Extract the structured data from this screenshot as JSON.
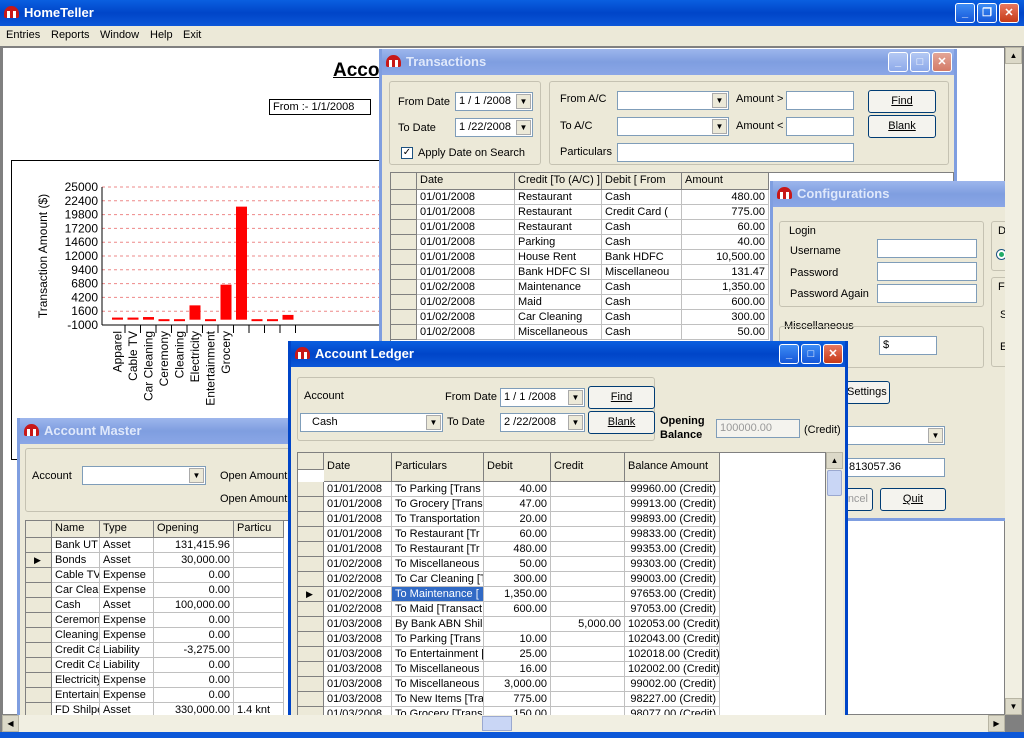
{
  "app": {
    "title": "HomeTeller",
    "menu": [
      "Entries",
      "Reports",
      "Window",
      "Help",
      "Exit"
    ]
  },
  "report": {
    "title": "Acco",
    "from_label": "From :- 1/1/2008",
    "ylabel": "Transaction Amount ($)",
    "chart_data": {
      "type": "bar",
      "title": "",
      "xlabel": "",
      "ylabel": "Transaction Amount ($)",
      "yticks": [
        25000,
        22400,
        19800,
        17200,
        14600,
        12000,
        9400,
        6800,
        4200,
        1600,
        -1000
      ],
      "ylim": [
        -1000,
        25000
      ],
      "grid": true,
      "colors": [
        "#ff0000"
      ],
      "categories": [
        "Apparel",
        "Cable TV",
        "Car Cleaning",
        "Ceremony",
        "Cleaning",
        "Electricity",
        "Entertainment",
        "Grocery",
        "",
        "",
        "",
        ""
      ],
      "values": [
        400,
        400,
        500,
        100,
        100,
        2700,
        100,
        6600,
        21300,
        100,
        100,
        900
      ]
    }
  },
  "transactions": {
    "title": "Transactions",
    "from_date_label": "From Date",
    "from_date": "1 / 1 /2008",
    "to_date_label": "To Date",
    "to_date": "1 /22/2008",
    "apply_label": "Apply Date on Search",
    "from_ac_label": "From A/C",
    "to_ac_label": "To A/C",
    "amount_gt_label": "Amount >",
    "amount_lt_label": "Amount <",
    "particulars_label": "Particulars",
    "find": "Find",
    "blank": "Blank",
    "columns": [
      "Date",
      "Credit [To (A/C) ]",
      "Debit [ From",
      "Amount"
    ],
    "rows": [
      [
        "01/01/2008",
        "Restaurant",
        "Cash",
        "480.00"
      ],
      [
        "01/01/2008",
        "Restaurant",
        "Credit Card (",
        "775.00"
      ],
      [
        "01/01/2008",
        "Restaurant",
        "Cash",
        "60.00"
      ],
      [
        "01/01/2008",
        "Parking",
        "Cash",
        "40.00"
      ],
      [
        "01/01/2008",
        "House Rent",
        "Bank HDFC",
        "10,500.00"
      ],
      [
        "01/01/2008",
        "Bank HDFC SI",
        "Miscellaneou",
        "131.47"
      ],
      [
        "01/02/2008",
        "Maintenance",
        "Cash",
        "1,350.00"
      ],
      [
        "01/02/2008",
        "Maid",
        "Cash",
        "600.00"
      ],
      [
        "01/02/2008",
        "Car Cleaning",
        "Cash",
        "300.00"
      ],
      [
        "01/02/2008",
        "Miscellaneous",
        "Cash",
        "50.00"
      ]
    ]
  },
  "config": {
    "title": "Configurations",
    "login_label": "Login",
    "username_label": "Username",
    "password_label": "Password",
    "password_again_label": "Password Again",
    "misc_label": "Miscellaneous",
    "currency_value": "$",
    "settings_btn": "Settings",
    "group_d": "D",
    "group_fi": "Fi",
    "s_label": "S",
    "e_label": "E",
    "balance": "813057.36",
    "cancel": "ncel",
    "quit": "Quit"
  },
  "account_master": {
    "title": "Account Master",
    "account_label": "Account",
    "open_amount_label": "Open Amount",
    "open_amount_label2": "Open Amount",
    "columns": [
      "Name",
      "Type",
      "Opening",
      "Particu"
    ],
    "rows": [
      [
        "Bank UT",
        "Asset",
        "131,415.96",
        ""
      ],
      [
        "Bonds",
        "Asset",
        "30,000.00",
        ""
      ],
      [
        "Cable TV",
        "Expense",
        "0.00",
        ""
      ],
      [
        "Car Clear",
        "Expense",
        "0.00",
        ""
      ],
      [
        "Cash",
        "Asset",
        "100,000.00",
        ""
      ],
      [
        "Ceremon",
        "Expense",
        "0.00",
        ""
      ],
      [
        "Cleaning",
        "Expense",
        "0.00",
        ""
      ],
      [
        "Credit Ca",
        "Liability",
        "-3,275.00",
        ""
      ],
      [
        "Credit Ca",
        "Liability",
        "0.00",
        ""
      ],
      [
        "Electricity",
        "Expense",
        "0.00",
        ""
      ],
      [
        "Entertain",
        "Expense",
        "0.00",
        ""
      ],
      [
        "FD Shilpe",
        "Asset",
        "330,000.00",
        "1.4 knt"
      ]
    ]
  },
  "ledger": {
    "title": "Account Ledger",
    "account_label": "Account",
    "account_value": "Cash",
    "from_date_label": "From Date",
    "from_date": "1 / 1 /2008",
    "to_date_label": "To Date",
    "to_date": "2 /22/2008",
    "find": "Find",
    "blank": "Blank",
    "opening_label": "Opening",
    "balance_label": "Balance",
    "opening_value": "100000.00",
    "credit_label": "(Credit)",
    "columns": [
      "Date",
      "Particulars",
      "Debit",
      "Credit",
      "Balance Amount"
    ],
    "rows": [
      [
        "01/01/2008",
        "To Parking [Trans",
        "40.00",
        "",
        "99960.00 (Credit)"
      ],
      [
        "01/01/2008",
        "To Grocery [Trans",
        "47.00",
        "",
        "99913.00 (Credit)"
      ],
      [
        "01/01/2008",
        "To Transportation",
        "20.00",
        "",
        "99893.00 (Credit)"
      ],
      [
        "01/01/2008",
        "To Restaurant [Tr",
        "60.00",
        "",
        "99833.00 (Credit)"
      ],
      [
        "01/01/2008",
        "To Restaurant [Tr",
        "480.00",
        "",
        "99353.00 (Credit)"
      ],
      [
        "01/02/2008",
        "To Miscellaneous",
        "50.00",
        "",
        "99303.00 (Credit)"
      ],
      [
        "01/02/2008",
        "To Car Cleaning [T",
        "300.00",
        "",
        "99003.00 (Credit)"
      ],
      [
        "01/02/2008",
        "To Maintenance [",
        "1,350.00",
        "",
        "97653.00 (Credit)"
      ],
      [
        "01/02/2008",
        "To Maid [Transact",
        "600.00",
        "",
        "97053.00 (Credit)"
      ],
      [
        "01/03/2008",
        "By Bank ABN Shil",
        "",
        "5,000.00",
        "102053.00 (Credit)"
      ],
      [
        "01/03/2008",
        "To Parking [Trans",
        "10.00",
        "",
        "102043.00 (Credit)"
      ],
      [
        "01/03/2008",
        "To Entertainment [",
        "25.00",
        "",
        "102018.00 (Credit)"
      ],
      [
        "01/03/2008",
        "To Miscellaneous",
        "16.00",
        "",
        "102002.00 (Credit)"
      ],
      [
        "01/03/2008",
        "To Miscellaneous",
        "3,000.00",
        "",
        "99002.00 (Credit)"
      ],
      [
        "01/03/2008",
        "To New Items [Tra",
        "775.00",
        "",
        "98227.00 (Credit)"
      ],
      [
        "01/03/2008",
        "To Grocery [Trans",
        "150.00",
        "",
        "98077.00 (Credit)"
      ]
    ]
  }
}
